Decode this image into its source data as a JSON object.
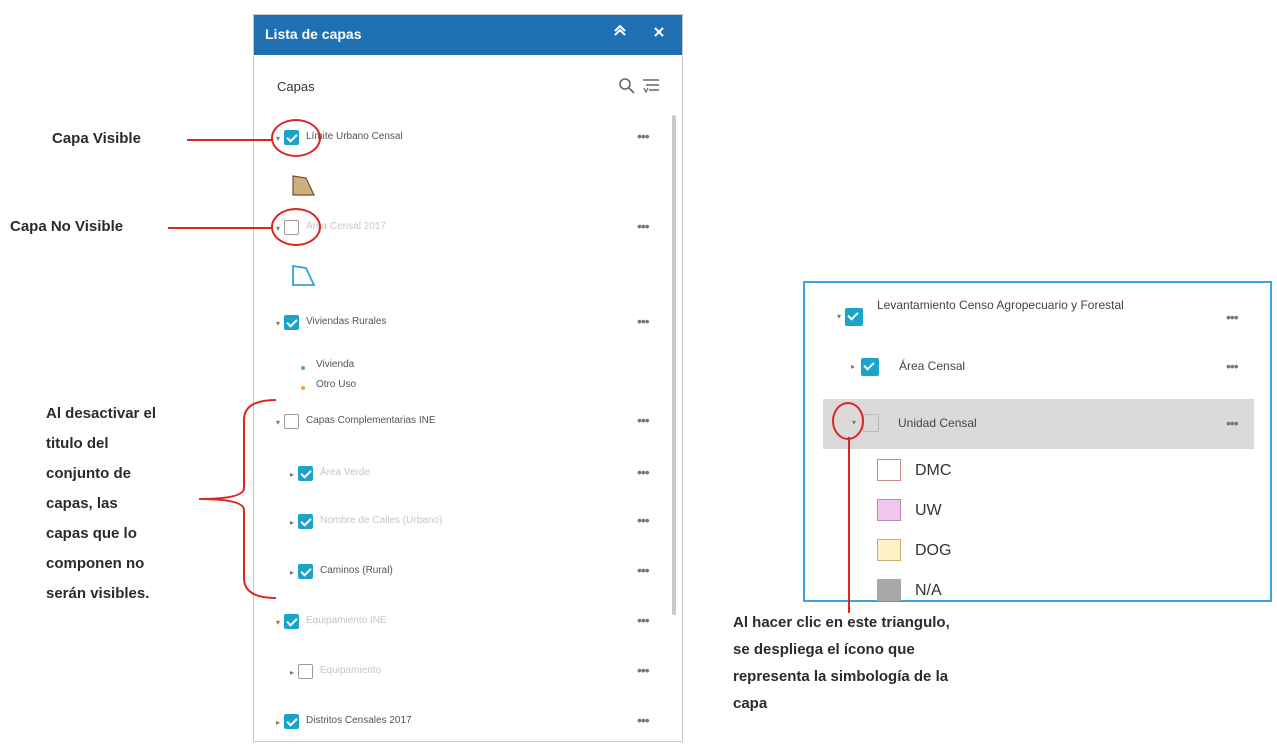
{
  "panel": {
    "title": "Lista de capas",
    "subheader": "Capas",
    "collapse_icon": "chevron-up-icon",
    "close_icon": "close-icon",
    "search_icon": "search-icon",
    "filter_icon": "filter-list-icon",
    "more_label": "•••",
    "layers": [
      {
        "label": "Límite Urbano Censal",
        "checked": true
      },
      {
        "label": "Área Censal 2017",
        "checked": false
      },
      {
        "label": "Viviendas Rurales",
        "checked": true
      },
      {
        "label": "Capas Complementarias INE",
        "checked": false
      },
      {
        "label": "Área Verde",
        "checked": true
      },
      {
        "label": "Nombre de Calles (Urbano)",
        "checked": true
      },
      {
        "label": "Caminos (Rural)",
        "checked": true
      },
      {
        "label": "Equipamiento INE",
        "checked": true
      },
      {
        "label": "Equipamiento",
        "checked": false
      },
      {
        "label": "Distritos Censales 2017",
        "checked": true
      }
    ],
    "legend_vivienda": "Vivienda",
    "legend_otro_uso": "Otro Uso"
  },
  "annotations": {
    "capa_visible": "Capa Visible",
    "capa_no_visible": "Capa No Visible",
    "group_note": [
      "Al desactivar el",
      "titulo del",
      "conjunto de",
      "capas, las",
      "capas que lo",
      "componen no",
      "serán visibles."
    ],
    "triangle_note": [
      "Al hacer clic en este triangulo,",
      "se despliega el ícono que",
      "representa la simbología de la",
      "capa"
    ]
  },
  "inset": {
    "rows": [
      {
        "label": "Levantamiento Censo Agropecuario y Forestal"
      },
      {
        "label": "Área Censal"
      },
      {
        "label": "Unidad Censal"
      }
    ],
    "symbols": [
      {
        "label": "DMC",
        "fill": "#ffffff",
        "stroke": "#c98a8a"
      },
      {
        "label": "UW",
        "fill": "#f1c6ef",
        "stroke": "#b68ab3"
      },
      {
        "label": "DOG",
        "fill": "#fff1c8",
        "stroke": "#d1a878"
      },
      {
        "label": "N/A",
        "fill": "#a9a9a9",
        "stroke": "#a9a9a9"
      }
    ],
    "more_label": "•••"
  },
  "colors": {
    "header": "#1f6fb3",
    "checkbox": "#1ba4c9",
    "annotation_red": "#e02424",
    "inset_border": "#3aa3e0"
  }
}
